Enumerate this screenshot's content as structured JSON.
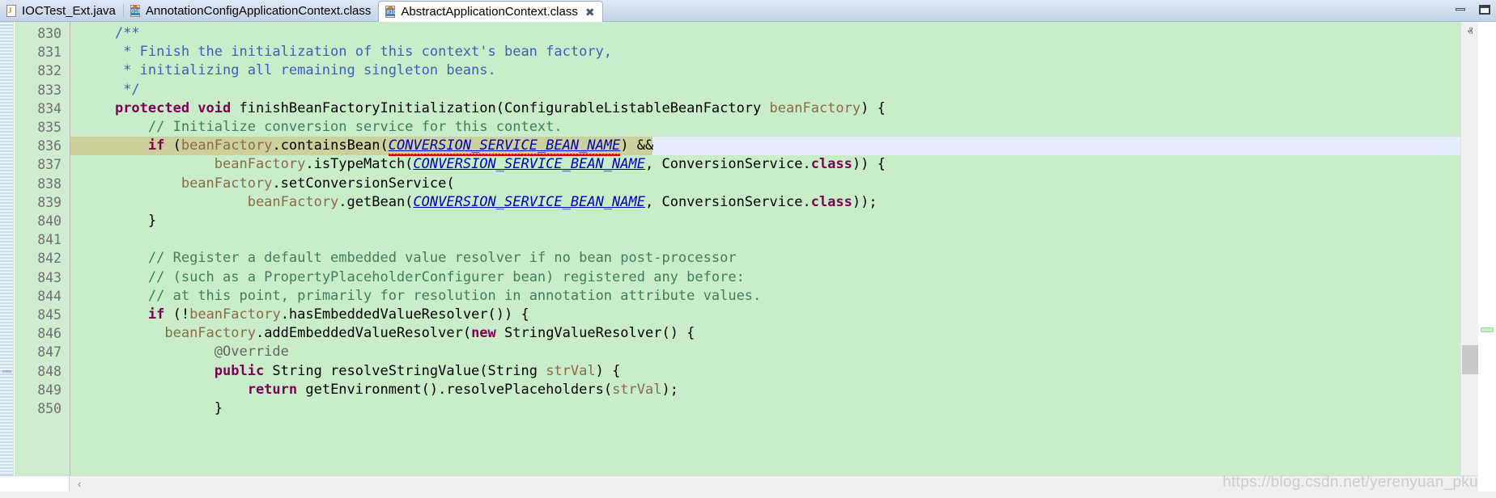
{
  "window": {
    "minimize_label": "–",
    "maximize_label": "❐"
  },
  "tabs": [
    {
      "label": "IOCTest_Ext.java",
      "icon": "java-file-icon",
      "active": false,
      "closable": false
    },
    {
      "label": "AnnotationConfigApplicationContext.class",
      "icon": "class-file-icon",
      "active": false,
      "closable": false
    },
    {
      "label": "AbstractApplicationContext.class",
      "icon": "class-file-icon",
      "active": true,
      "closable": true,
      "close_label": "✖"
    }
  ],
  "editor": {
    "first_line": 830,
    "line_numbers": [
      "830",
      "831",
      "832",
      "833",
      "834",
      "835",
      "836",
      "837",
      "838",
      "839",
      "840",
      "841",
      "842",
      "843",
      "844",
      "845",
      "846",
      "847",
      "848",
      "849",
      "850"
    ],
    "fold_lines": [
      "830",
      "834"
    ],
    "current_line": "836",
    "lines": [
      {
        "n": "830",
        "fold": true,
        "tokens": [
          {
            "t": "    ",
            "c": "plain"
          },
          {
            "t": "/**",
            "c": "jdoc"
          }
        ]
      },
      {
        "n": "831",
        "tokens": [
          {
            "t": "     * Finish the initialization of this context's bean factory,",
            "c": "jdoc"
          }
        ]
      },
      {
        "n": "832",
        "tokens": [
          {
            "t": "     * initializing all remaining singleton beans.",
            "c": "jdoc"
          }
        ]
      },
      {
        "n": "833",
        "tokens": [
          {
            "t": "     */",
            "c": "jdoc"
          }
        ]
      },
      {
        "n": "834",
        "fold": true,
        "tokens": [
          {
            "t": "    ",
            "c": "plain"
          },
          {
            "t": "protected void",
            "c": "kw"
          },
          {
            "t": " finishBeanFactoryInitialization(ConfigurableListableBeanFactory ",
            "c": "plain"
          },
          {
            "t": "beanFactory",
            "c": "fld"
          },
          {
            "t": ") {",
            "c": "plain"
          }
        ]
      },
      {
        "n": "835",
        "tokens": [
          {
            "t": "        ",
            "c": "plain"
          },
          {
            "t": "// Initialize conversion service for this context.",
            "c": "cmt"
          }
        ]
      },
      {
        "n": "836",
        "tokens": [
          {
            "t": "        ",
            "c": "plain"
          },
          {
            "t": "if",
            "c": "kw"
          },
          {
            "t": " (",
            "c": "plain"
          },
          {
            "t": "beanFactory",
            "c": "fld"
          },
          {
            "t": ".containsBean(",
            "c": "plain"
          },
          {
            "t": "CONVERSION_SERVICE_BEAN_NAME",
            "c": "sfld",
            "squiggle": true
          },
          {
            "t": ") &&",
            "c": "plain"
          }
        ]
      },
      {
        "n": "837",
        "tokens": [
          {
            "t": "                ",
            "c": "plain"
          },
          {
            "t": "beanFactory",
            "c": "fld"
          },
          {
            "t": ".isTypeMatch(",
            "c": "plain"
          },
          {
            "t": "CONVERSION_SERVICE_BEAN_NAME",
            "c": "sfld"
          },
          {
            "t": ", ConversionService.",
            "c": "plain"
          },
          {
            "t": "class",
            "c": "kw"
          },
          {
            "t": ")) {",
            "c": "plain"
          }
        ]
      },
      {
        "n": "838",
        "tokens": [
          {
            "t": "            ",
            "c": "plain"
          },
          {
            "t": "beanFactory",
            "c": "fld"
          },
          {
            "t": ".setConversionService(",
            "c": "plain"
          }
        ]
      },
      {
        "n": "839",
        "tokens": [
          {
            "t": "                    ",
            "c": "plain"
          },
          {
            "t": "beanFactory",
            "c": "fld"
          },
          {
            "t": ".getBean(",
            "c": "plain"
          },
          {
            "t": "CONVERSION_SERVICE_BEAN_NAME",
            "c": "sfld"
          },
          {
            "t": ", ConversionService.",
            "c": "plain"
          },
          {
            "t": "class",
            "c": "kw"
          },
          {
            "t": "));",
            "c": "plain"
          }
        ]
      },
      {
        "n": "840",
        "tokens": [
          {
            "t": "        }",
            "c": "plain"
          }
        ]
      },
      {
        "n": "841",
        "tokens": [
          {
            "t": "",
            "c": "plain"
          }
        ]
      },
      {
        "n": "842",
        "tokens": [
          {
            "t": "        ",
            "c": "plain"
          },
          {
            "t": "// Register a default embedded value resolver if no bean post-processor",
            "c": "cmt"
          }
        ]
      },
      {
        "n": "843",
        "tokens": [
          {
            "t": "        ",
            "c": "plain"
          },
          {
            "t": "// (such as a PropertyPlaceholderConfigurer bean) registered any before:",
            "c": "cmt"
          }
        ]
      },
      {
        "n": "844",
        "tokens": [
          {
            "t": "        ",
            "c": "plain"
          },
          {
            "t": "// at this point, primarily for resolution in annotation attribute values.",
            "c": "cmt"
          }
        ]
      },
      {
        "n": "845",
        "tokens": [
          {
            "t": "        ",
            "c": "plain"
          },
          {
            "t": "if",
            "c": "kw"
          },
          {
            "t": " (!",
            "c": "plain"
          },
          {
            "t": "beanFactory",
            "c": "fld"
          },
          {
            "t": ".hasEmbeddedValueResolver()) {",
            "c": "plain"
          }
        ]
      },
      {
        "n": "846",
        "tokens": [
          {
            "t": "          ",
            "c": "plain"
          },
          {
            "t": "beanFactory",
            "c": "fld"
          },
          {
            "t": ".addEmbeddedValueResolver(",
            "c": "plain"
          },
          {
            "t": "new",
            "c": "kw"
          },
          {
            "t": " StringValueResolver() {",
            "c": "plain"
          }
        ]
      },
      {
        "n": "847",
        "tokens": [
          {
            "t": "                ",
            "c": "plain"
          },
          {
            "t": "@Override",
            "c": "ann"
          }
        ]
      },
      {
        "n": "848",
        "quickfix": true,
        "tokens": [
          {
            "t": "                ",
            "c": "plain"
          },
          {
            "t": "public",
            "c": "kw"
          },
          {
            "t": " String resolveStringValue(String ",
            "c": "plain"
          },
          {
            "t": "strVal",
            "c": "fld"
          },
          {
            "t": ") {",
            "c": "plain"
          }
        ]
      },
      {
        "n": "849",
        "tokens": [
          {
            "t": "                    ",
            "c": "plain"
          },
          {
            "t": "return",
            "c": "kw"
          },
          {
            "t": " getEnvironment().resolvePlaceholders(",
            "c": "plain"
          },
          {
            "t": "strVal",
            "c": "fld"
          },
          {
            "t": ");",
            "c": "plain"
          }
        ]
      },
      {
        "n": "850",
        "tokens": [
          {
            "t": "                }",
            "c": "plain"
          }
        ]
      }
    ]
  },
  "scrollbars": {
    "vertical_up_label": "ⱏ",
    "vertical_down_label": "ⱟ",
    "horizontal_left_label": "‹"
  },
  "watermark": "https://blog.csdn.net/yerenyuan_pku",
  "colors": {
    "code_background": "#c9edc9",
    "gutter_background": "#d0ecd0",
    "current_line": "#e6eefb",
    "selection": "#cdd09a",
    "keyword": "#7f0055",
    "comment": "#3f7f5f",
    "javadoc": "#3f5fbf",
    "field": "#8b6a4a",
    "static_field": "#0000c0",
    "annotation": "#646464",
    "tab_bar": "#cfdcec",
    "error_underline": "#e00000"
  }
}
